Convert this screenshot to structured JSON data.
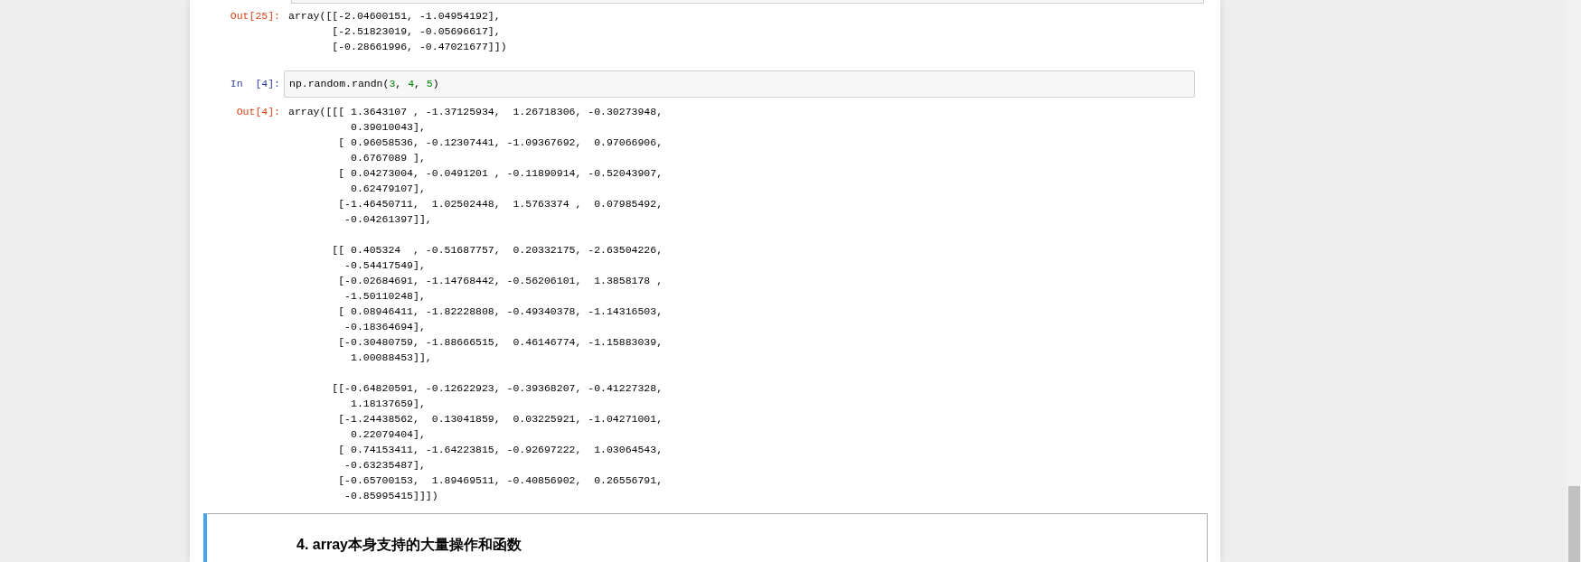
{
  "cells": [
    {
      "kind": "output",
      "prompt": "Out[25]:",
      "text": "array([[-2.04600151, -1.04954192],\n       [-2.51823019, -0.05696617],\n       [-0.28661996, -0.47021677]])"
    },
    {
      "kind": "input",
      "prompt": "In  [4]:",
      "code": [
        {
          "kind": "plain",
          "text": "np.random.randn("
        },
        {
          "kind": "number",
          "text": "3"
        },
        {
          "kind": "plain",
          "text": ", "
        },
        {
          "kind": "number",
          "text": "4"
        },
        {
          "kind": "plain",
          "text": ", "
        },
        {
          "kind": "number",
          "text": "5"
        },
        {
          "kind": "plain",
          "text": ")"
        }
      ]
    },
    {
      "kind": "output",
      "prompt": "Out[4]:",
      "text": "array([[[ 1.3643107 , -1.37125934,  1.26718306, -0.30273948,\n          0.39010043],\n        [ 0.96058536, -0.12307441, -1.09367692,  0.97066906,\n          0.6767089 ],\n        [ 0.04273004, -0.0491201 , -0.11890914, -0.52043907,\n          0.62479107],\n        [-1.46450711,  1.02502448,  1.5763374 ,  0.07985492,\n         -0.04261397]],\n\n       [[ 0.405324  , -0.51687757,  0.20332175, -2.63504226,\n         -0.54417549],\n        [-0.02684691, -1.14768442, -0.56206101,  1.3858178 ,\n         -1.50110248],\n        [ 0.08946411, -1.82228808, -0.49340378, -1.14316503,\n         -0.18364694],\n        [-0.30480759, -1.88666515,  0.46146774, -1.15883039,\n          1.00088453]],\n\n       [[-0.64820591, -0.12622923, -0.39368207, -0.41227328,\n          1.18137659],\n        [-1.24438562,  0.13041859,  0.03225921, -1.04271001,\n          0.22079404],\n        [ 0.74153411, -1.64223815, -0.92697222,  1.03064543,\n         -0.63235487],\n        [-0.65700153,  1.89469511, -0.40856902,  0.26556791,\n         -0.85995415]]])"
    },
    {
      "kind": "markdown",
      "heading": "4. array本身支持的大量操作和函数"
    }
  ]
}
